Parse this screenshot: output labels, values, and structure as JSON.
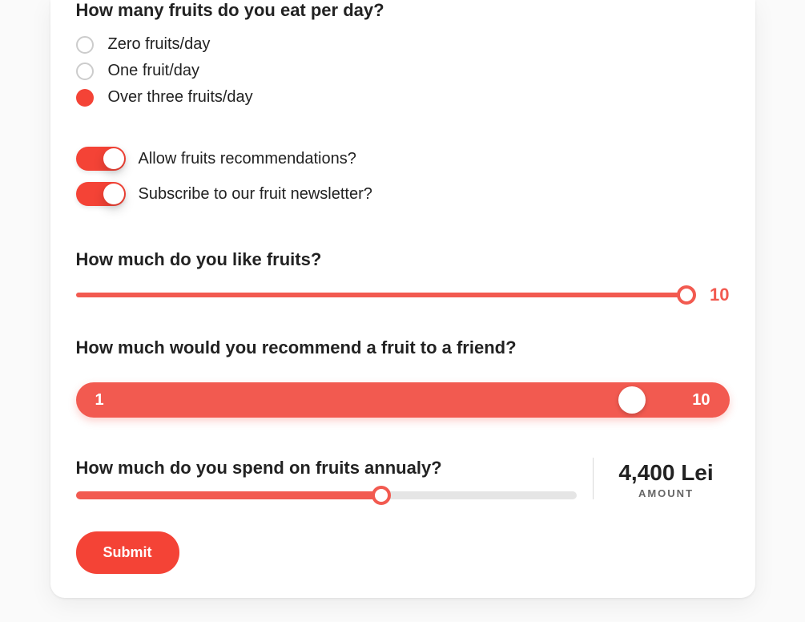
{
  "q_fruits": {
    "title": "How many fruits do you eat per day?",
    "options": [
      {
        "label": "Zero fruits/day",
        "checked": false
      },
      {
        "label": "One fruit/day",
        "checked": false
      },
      {
        "label": "Over three fruits/day",
        "checked": true
      }
    ]
  },
  "toggles": [
    {
      "label": "Allow fruits recommendations?",
      "on": true
    },
    {
      "label": "Subscribe to our fruit newsletter?",
      "on": true
    }
  ],
  "slider_like": {
    "title": "How much do you like fruits?",
    "value": "10"
  },
  "slider_recommend": {
    "title": "How much would you recommend a fruit to a friend?",
    "min": "1",
    "max": "10"
  },
  "slider_spend": {
    "title": "How much do you spend on fruits annualy?",
    "amount": "4,400 Lei",
    "amount_label": "AMOUNT"
  },
  "submit_label": "Submit"
}
